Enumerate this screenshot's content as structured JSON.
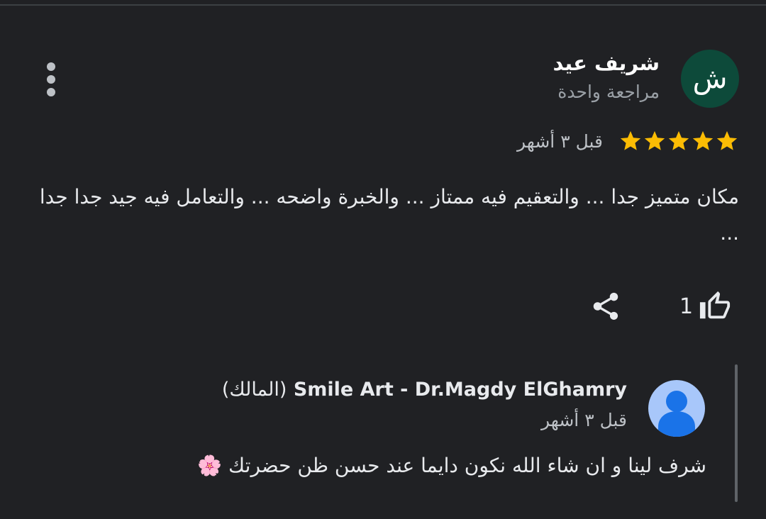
{
  "review": {
    "avatar_letter": "ش",
    "reviewer_name": "شريف عيد",
    "review_count": "مراجعة واحدة",
    "rating": 5,
    "rating_max": 5,
    "time": "قبل ٣ أشهر",
    "text": "مكان متميز جدا ... والتعقيم فيه ممتاز ... والخبرة واضحه ... والتعامل فيه جيد جدا جدا ...",
    "like_count": "1",
    "colors": {
      "avatar_bg": "#0d4a3a",
      "star": "#fbbc04"
    }
  },
  "icons": {
    "more": "more-vert-icon",
    "like": "thumb-up-icon",
    "share": "share-icon",
    "star": "star-icon",
    "owner_avatar": "person-icon",
    "flower": "cherry-blossom-emoji"
  },
  "owner_reply": {
    "owner_name": "Smile Art - Dr.Magdy ElGhamry",
    "owner_tag": "(المالك)",
    "time": "قبل ٣ أشهر",
    "text": "شرف لينا و ان شاء الله نكون دايما عند حسن ظن حضرتك",
    "emoji": "🌸",
    "colors": {
      "avatar_bg": "#a8c7fa",
      "avatar_fg": "#1a73e8"
    }
  }
}
